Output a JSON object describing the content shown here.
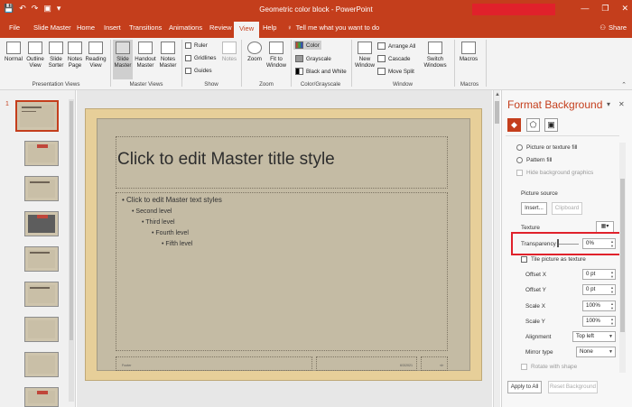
{
  "window": {
    "title": "Geometric color block - PowerPoint",
    "minimize": "—",
    "restore": "❐",
    "close": "✕"
  },
  "qat": {
    "save": "💾",
    "undo": "↶",
    "redo": "↷",
    "present": "▣",
    "more": "▾"
  },
  "tabs": [
    "File",
    "Slide Master",
    "Home",
    "Insert",
    "Transitions",
    "Animations",
    "Review",
    "View",
    "Help"
  ],
  "active_tab": "View",
  "tell_me": "Tell me what you want to do",
  "share": "Share",
  "ribbon": {
    "presentation_views": {
      "label": "Presentation Views",
      "buttons": [
        "Normal",
        "Outline View",
        "Slide Sorter",
        "Notes Page",
        "Reading View"
      ]
    },
    "master_views": {
      "label": "Master Views",
      "buttons": [
        "Slide Master",
        "Handout Master",
        "Notes Master"
      ]
    },
    "show": {
      "label": "Show",
      "items": [
        "Ruler",
        "Gridlines",
        "Guides"
      ],
      "notes": "Notes"
    },
    "zoom": {
      "label": "Zoom",
      "buttons": [
        "Zoom",
        "Fit to Window"
      ]
    },
    "color": {
      "label": "Color/Grayscale",
      "items": [
        "Color",
        "Grayscale",
        "Black and White"
      ]
    },
    "window": {
      "label": "Window",
      "new_window": "New Window",
      "items": [
        "Arrange All",
        "Cascade",
        "Move Split"
      ],
      "switch": "Switch Windows"
    },
    "macros": {
      "label": "Macros",
      "button": "Macros"
    }
  },
  "thumbnails": {
    "selected_number": "1",
    "count": 8
  },
  "slide": {
    "title": "Click to edit Master title style",
    "levels": [
      "Click to edit Master text styles",
      "Second level",
      "Third level",
      "Fourth level",
      "Fifth level"
    ],
    "footer": "Footer",
    "date": "6/3/2021",
    "page": "‹#›"
  },
  "format_panel": {
    "title": "Format Background",
    "options": {
      "picture_fill": "Picture or texture fill",
      "pattern_fill": "Pattern fill",
      "hide_bg": "Hide background graphics"
    },
    "picture_source": "Picture source",
    "insert_btn": "Insert...",
    "clipboard_btn": "Clipboard",
    "texture": "Texture",
    "transparency": {
      "label": "Transparency",
      "value": "0%"
    },
    "tile": "Tile picture as texture",
    "offset_x": {
      "label": "Offset X",
      "value": "0 pt"
    },
    "offset_y": {
      "label": "Offset Y",
      "value": "0 pt"
    },
    "scale_x": {
      "label": "Scale X",
      "value": "100%"
    },
    "scale_y": {
      "label": "Scale Y",
      "value": "100%"
    },
    "alignment": {
      "label": "Alignment",
      "value": "Top left"
    },
    "mirror": {
      "label": "Mirror type",
      "value": "None"
    },
    "rotate": "Rotate with shape",
    "apply_all": "Apply to All",
    "reset": "Reset Background"
  }
}
